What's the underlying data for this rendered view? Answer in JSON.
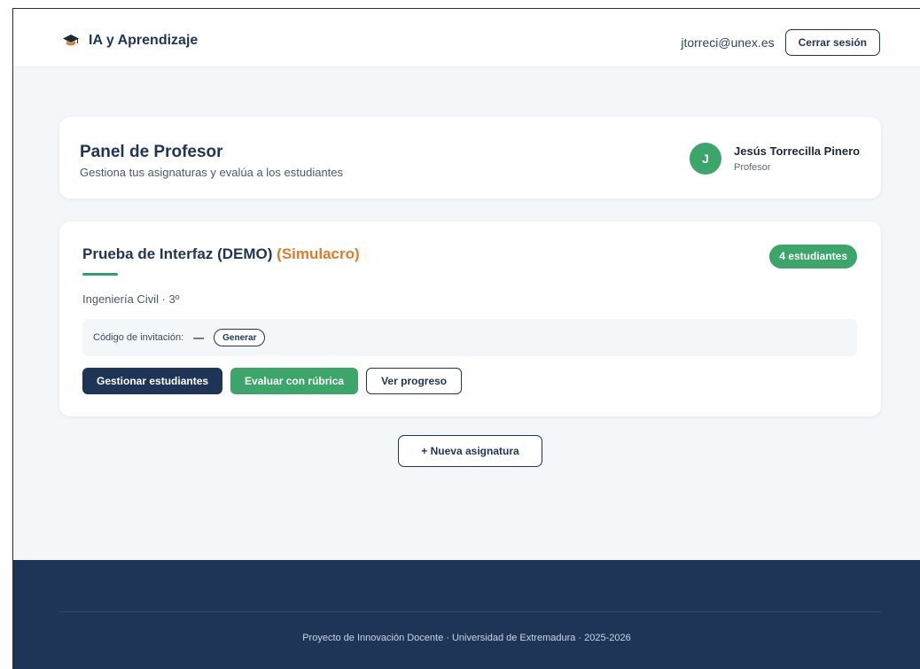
{
  "header": {
    "brand": "IA y Aprendizaje",
    "brand_icon": "graduation-cap-icon",
    "user_email": "jtorreci@unex.es",
    "logout_label": "Cerrar sesión"
  },
  "panel": {
    "title": "Panel de Profesor",
    "subtitle": "Gestiona tus asignaturas y evalúa a los estudiantes",
    "avatar_initial": "J",
    "user_name": "Jesús Torrecilla Pinero",
    "user_role": "Profesor"
  },
  "course": {
    "title": "Prueba de Interfaz (DEMO)",
    "tag": "(Simulacro)",
    "students_badge": "4 estudiantes",
    "meta": "Ingeniería Civil · 3º",
    "invite_label": "Código de invitación:",
    "invite_code": "—",
    "generate_label": "Generar",
    "actions": {
      "manage": "Gestionar estudiantes",
      "evaluate": "Evaluar con rúbrica",
      "progress": "Ver progreso"
    }
  },
  "new_subject_label": "+ Nueva asignatura",
  "footer": {
    "text": "Proyecto de Innovación Docente · Universidad de Extremadura · 2025-2026"
  },
  "colors": {
    "primary": "#1e3557",
    "accent_green": "#3ba56a",
    "accent_orange": "#e07b2c",
    "background": "#f3f7fa"
  }
}
